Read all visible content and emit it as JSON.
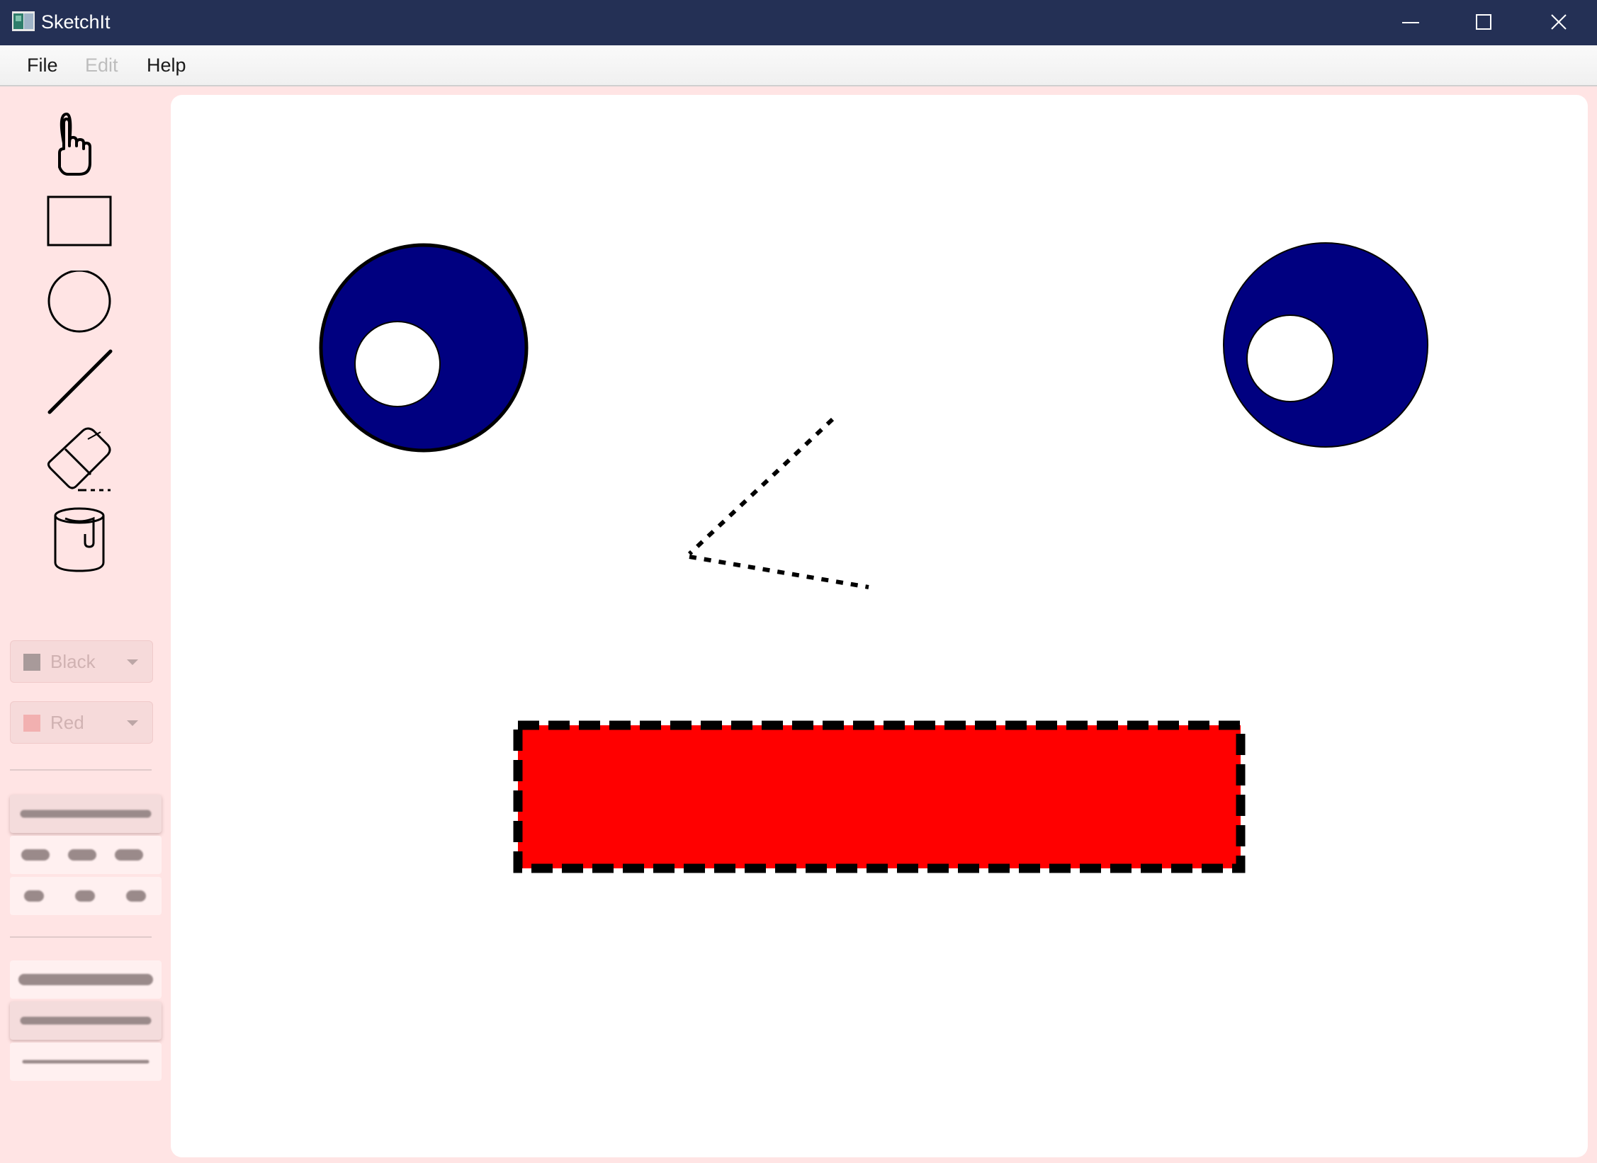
{
  "window": {
    "title": "SketchIt",
    "controls": [
      "minimize",
      "maximize",
      "close"
    ]
  },
  "menu": {
    "file": "File",
    "edit": "Edit",
    "help": "Help",
    "edit_disabled": true
  },
  "tools": [
    {
      "name": "pointer-hand-icon",
      "label": ""
    },
    {
      "name": "rectangle-icon",
      "label": ""
    },
    {
      "name": "ellipse-icon",
      "label": ""
    },
    {
      "name": "line-icon",
      "label": ""
    },
    {
      "name": "eraser-icon",
      "label": ""
    },
    {
      "name": "paint-bucket-icon",
      "label": ""
    }
  ],
  "stroke_color": {
    "label": "Black",
    "swatch": "#a89a9a",
    "disabled": true
  },
  "fill_color": {
    "label": "Red",
    "swatch": "#f2b0b0",
    "disabled": true
  },
  "line_styles": [
    {
      "style": "solid",
      "selected": true
    },
    {
      "style": "dashed",
      "selected": false
    },
    {
      "style": "dotted",
      "selected": false
    }
  ],
  "line_widths": [
    {
      "width": "thick",
      "selected": false
    },
    {
      "width": "medium",
      "selected": true
    },
    {
      "width": "thin",
      "selected": false
    }
  ],
  "colors": {
    "titlebar": "#243055",
    "sidebar": "#ffe4e4",
    "eye_fill": "#000080",
    "mouth_fill": "#ff0000"
  },
  "canvas": {
    "shapes": [
      {
        "type": "ellipse",
        "fill": "#000080",
        "stroke": "#000000",
        "stroke_style": "solid"
      },
      {
        "type": "ellipse",
        "fill": "#ffffff",
        "stroke": "#000000",
        "stroke_style": "solid"
      },
      {
        "type": "ellipse",
        "fill": "#000080",
        "stroke": "#000000",
        "stroke_style": "solid"
      },
      {
        "type": "ellipse",
        "fill": "#ffffff",
        "stroke": "#000000",
        "stroke_style": "solid"
      },
      {
        "type": "line",
        "stroke": "#000000",
        "stroke_style": "dotted"
      },
      {
        "type": "line",
        "stroke": "#000000",
        "stroke_style": "dotted"
      },
      {
        "type": "rectangle",
        "fill": "#ff0000",
        "stroke": "#000000",
        "stroke_style": "dashed"
      }
    ]
  }
}
